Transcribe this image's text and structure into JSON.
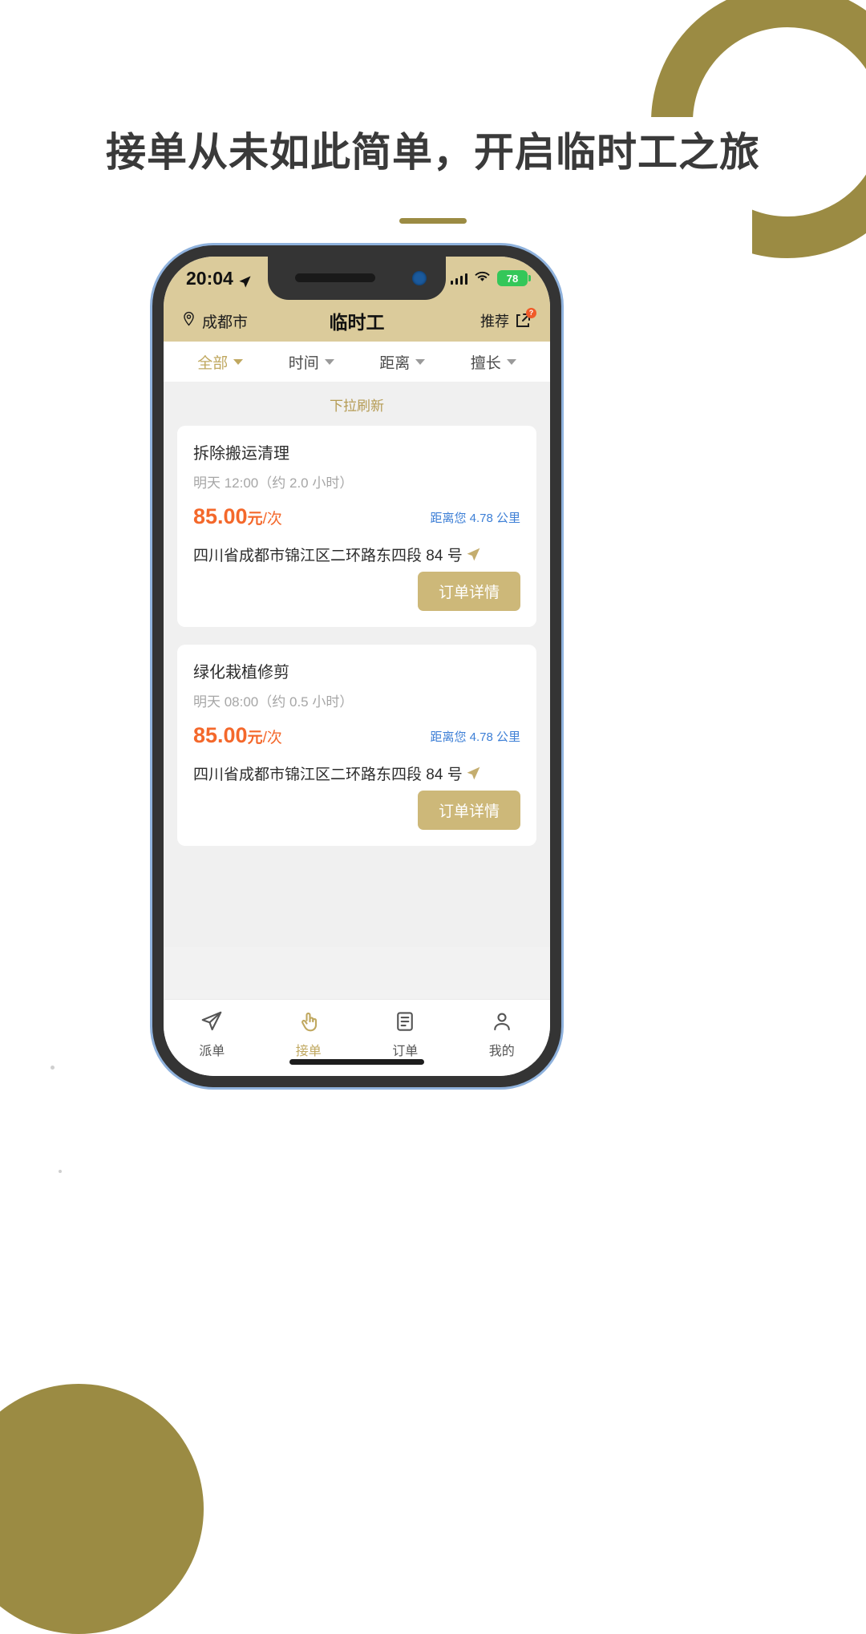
{
  "page": {
    "headline": "接单从未如此简单，开启临时工之旅",
    "accent_gold": "#9b8b43",
    "accent_tan": "#dbcb9b",
    "price_color": "#f4682b",
    "link_color": "#3d7fd6"
  },
  "statusbar": {
    "time": "20:04",
    "location_icon": "location-arrow-icon",
    "signal_icon": "cellular-signal-icon",
    "wifi_icon": "wifi-icon",
    "battery_level": "78"
  },
  "header": {
    "city": "成都市",
    "city_icon": "map-pin-icon",
    "title": "临时工",
    "recommend": "推荐",
    "share_icon": "share-icon",
    "share_badge": "?"
  },
  "filters": [
    {
      "label": "全部",
      "active": true
    },
    {
      "label": "时间",
      "active": false
    },
    {
      "label": "距离",
      "active": false
    },
    {
      "label": "擅长",
      "active": false
    }
  ],
  "list": {
    "refresh_hint": "下拉刷新",
    "cards": [
      {
        "title": "拆除搬运清理",
        "time": "明天 12:00（约 2.0 小时）",
        "price": "85.00",
        "unit": "元",
        "per": "/次",
        "distance": "距离您 4.78 公里",
        "address": "四川省成都市锦江区二环路东四段 84 号",
        "nav_icon": "navigate-arrow-icon",
        "detail_button": "订单详情"
      },
      {
        "title": "绿化栽植修剪",
        "time": "明天 08:00（约 0.5 小时）",
        "price": "85.00",
        "unit": "元",
        "per": "/次",
        "distance": "距离您 4.78 公里",
        "address": "四川省成都市锦江区二环路东四段 84 号",
        "nav_icon": "navigate-arrow-icon",
        "detail_button": "订单详情"
      }
    ]
  },
  "tabbar": [
    {
      "label": "派单",
      "icon": "paper-plane-icon",
      "active": false
    },
    {
      "label": "接单",
      "icon": "tap-hand-icon",
      "active": true
    },
    {
      "label": "订单",
      "icon": "document-list-icon",
      "active": false
    },
    {
      "label": "我的",
      "icon": "user-profile-icon",
      "active": false
    }
  ]
}
